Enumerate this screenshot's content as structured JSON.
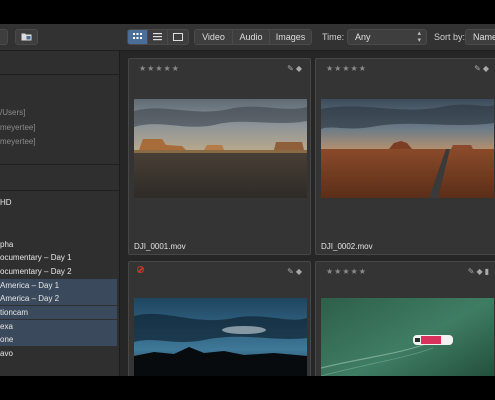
{
  "toolbar": {
    "view_icons": [
      "grid-view-icon",
      "list-view-icon",
      "single-view-icon"
    ],
    "filters": [
      "Video",
      "Audio",
      "Images"
    ],
    "time_label": "Time:",
    "time_value": "Any",
    "sort_label": "Sort by:",
    "sort_value": "Name"
  },
  "sidebar": {
    "paths": [
      "/Users]",
      "meyertee]",
      "meyertee]"
    ],
    "items": [
      "HD",
      "pha",
      "ocumentary – Day 1",
      "ocumentary – Day 2",
      "America – Day 1",
      "America – Day 2",
      "tioncam",
      "exa",
      "one",
      "avo"
    ]
  },
  "clips": [
    {
      "name": "DJI_0001.mov",
      "rating": "★★★★★"
    },
    {
      "name": "DJI_0002.mov",
      "rating": "★★★★★"
    },
    {
      "name": "",
      "rating": "★★★★★"
    },
    {
      "name": "",
      "rating": "★★★★★"
    }
  ],
  "colors": {
    "accent": "#4b6e98",
    "selected_row": "#3a4a5c",
    "reject_flag": "#c0392b"
  }
}
